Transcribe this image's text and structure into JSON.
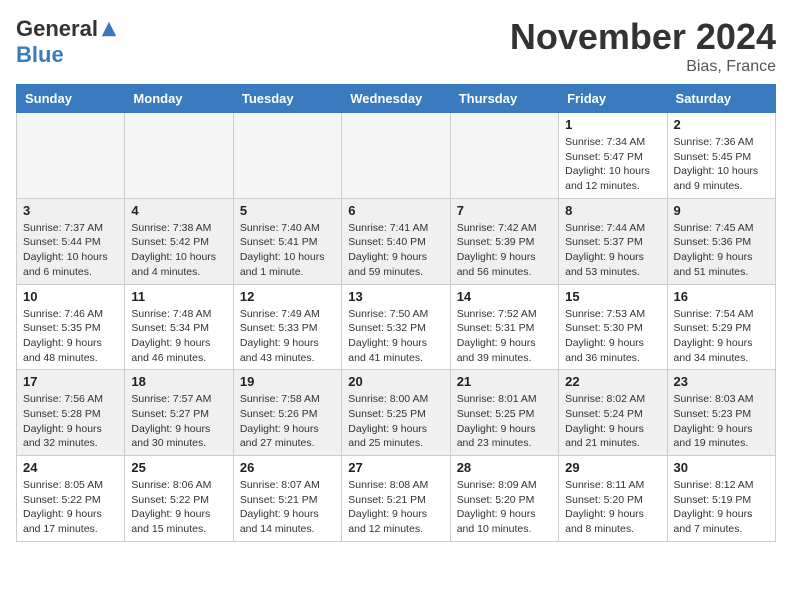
{
  "header": {
    "logo_general": "General",
    "logo_blue": "Blue",
    "month_title": "November 2024",
    "location": "Bias, France"
  },
  "weekdays": [
    "Sunday",
    "Monday",
    "Tuesday",
    "Wednesday",
    "Thursday",
    "Friday",
    "Saturday"
  ],
  "weeks": [
    [
      {
        "day": "",
        "empty": true
      },
      {
        "day": "",
        "empty": true
      },
      {
        "day": "",
        "empty": true
      },
      {
        "day": "",
        "empty": true
      },
      {
        "day": "",
        "empty": true
      },
      {
        "day": "1",
        "sunrise": "Sunrise: 7:34 AM",
        "sunset": "Sunset: 5:47 PM",
        "daylight": "Daylight: 10 hours and 12 minutes."
      },
      {
        "day": "2",
        "sunrise": "Sunrise: 7:36 AM",
        "sunset": "Sunset: 5:45 PM",
        "daylight": "Daylight: 10 hours and 9 minutes."
      }
    ],
    [
      {
        "day": "3",
        "sunrise": "Sunrise: 7:37 AM",
        "sunset": "Sunset: 5:44 PM",
        "daylight": "Daylight: 10 hours and 6 minutes."
      },
      {
        "day": "4",
        "sunrise": "Sunrise: 7:38 AM",
        "sunset": "Sunset: 5:42 PM",
        "daylight": "Daylight: 10 hours and 4 minutes."
      },
      {
        "day": "5",
        "sunrise": "Sunrise: 7:40 AM",
        "sunset": "Sunset: 5:41 PM",
        "daylight": "Daylight: 10 hours and 1 minute."
      },
      {
        "day": "6",
        "sunrise": "Sunrise: 7:41 AM",
        "sunset": "Sunset: 5:40 PM",
        "daylight": "Daylight: 9 hours and 59 minutes."
      },
      {
        "day": "7",
        "sunrise": "Sunrise: 7:42 AM",
        "sunset": "Sunset: 5:39 PM",
        "daylight": "Daylight: 9 hours and 56 minutes."
      },
      {
        "day": "8",
        "sunrise": "Sunrise: 7:44 AM",
        "sunset": "Sunset: 5:37 PM",
        "daylight": "Daylight: 9 hours and 53 minutes."
      },
      {
        "day": "9",
        "sunrise": "Sunrise: 7:45 AM",
        "sunset": "Sunset: 5:36 PM",
        "daylight": "Daylight: 9 hours and 51 minutes."
      }
    ],
    [
      {
        "day": "10",
        "sunrise": "Sunrise: 7:46 AM",
        "sunset": "Sunset: 5:35 PM",
        "daylight": "Daylight: 9 hours and 48 minutes."
      },
      {
        "day": "11",
        "sunrise": "Sunrise: 7:48 AM",
        "sunset": "Sunset: 5:34 PM",
        "daylight": "Daylight: 9 hours and 46 minutes."
      },
      {
        "day": "12",
        "sunrise": "Sunrise: 7:49 AM",
        "sunset": "Sunset: 5:33 PM",
        "daylight": "Daylight: 9 hours and 43 minutes."
      },
      {
        "day": "13",
        "sunrise": "Sunrise: 7:50 AM",
        "sunset": "Sunset: 5:32 PM",
        "daylight": "Daylight: 9 hours and 41 minutes."
      },
      {
        "day": "14",
        "sunrise": "Sunrise: 7:52 AM",
        "sunset": "Sunset: 5:31 PM",
        "daylight": "Daylight: 9 hours and 39 minutes."
      },
      {
        "day": "15",
        "sunrise": "Sunrise: 7:53 AM",
        "sunset": "Sunset: 5:30 PM",
        "daylight": "Daylight: 9 hours and 36 minutes."
      },
      {
        "day": "16",
        "sunrise": "Sunrise: 7:54 AM",
        "sunset": "Sunset: 5:29 PM",
        "daylight": "Daylight: 9 hours and 34 minutes."
      }
    ],
    [
      {
        "day": "17",
        "sunrise": "Sunrise: 7:56 AM",
        "sunset": "Sunset: 5:28 PM",
        "daylight": "Daylight: 9 hours and 32 minutes."
      },
      {
        "day": "18",
        "sunrise": "Sunrise: 7:57 AM",
        "sunset": "Sunset: 5:27 PM",
        "daylight": "Daylight: 9 hours and 30 minutes."
      },
      {
        "day": "19",
        "sunrise": "Sunrise: 7:58 AM",
        "sunset": "Sunset: 5:26 PM",
        "daylight": "Daylight: 9 hours and 27 minutes."
      },
      {
        "day": "20",
        "sunrise": "Sunrise: 8:00 AM",
        "sunset": "Sunset: 5:25 PM",
        "daylight": "Daylight: 9 hours and 25 minutes."
      },
      {
        "day": "21",
        "sunrise": "Sunrise: 8:01 AM",
        "sunset": "Sunset: 5:25 PM",
        "daylight": "Daylight: 9 hours and 23 minutes."
      },
      {
        "day": "22",
        "sunrise": "Sunrise: 8:02 AM",
        "sunset": "Sunset: 5:24 PM",
        "daylight": "Daylight: 9 hours and 21 minutes."
      },
      {
        "day": "23",
        "sunrise": "Sunrise: 8:03 AM",
        "sunset": "Sunset: 5:23 PM",
        "daylight": "Daylight: 9 hours and 19 minutes."
      }
    ],
    [
      {
        "day": "24",
        "sunrise": "Sunrise: 8:05 AM",
        "sunset": "Sunset: 5:22 PM",
        "daylight": "Daylight: 9 hours and 17 minutes."
      },
      {
        "day": "25",
        "sunrise": "Sunrise: 8:06 AM",
        "sunset": "Sunset: 5:22 PM",
        "daylight": "Daylight: 9 hours and 15 minutes."
      },
      {
        "day": "26",
        "sunrise": "Sunrise: 8:07 AM",
        "sunset": "Sunset: 5:21 PM",
        "daylight": "Daylight: 9 hours and 14 minutes."
      },
      {
        "day": "27",
        "sunrise": "Sunrise: 8:08 AM",
        "sunset": "Sunset: 5:21 PM",
        "daylight": "Daylight: 9 hours and 12 minutes."
      },
      {
        "day": "28",
        "sunrise": "Sunrise: 8:09 AM",
        "sunset": "Sunset: 5:20 PM",
        "daylight": "Daylight: 9 hours and 10 minutes."
      },
      {
        "day": "29",
        "sunrise": "Sunrise: 8:11 AM",
        "sunset": "Sunset: 5:20 PM",
        "daylight": "Daylight: 9 hours and 8 minutes."
      },
      {
        "day": "30",
        "sunrise": "Sunrise: 8:12 AM",
        "sunset": "Sunset: 5:19 PM",
        "daylight": "Daylight: 9 hours and 7 minutes."
      }
    ]
  ],
  "row_classes": [
    "row-a",
    "row-b",
    "row-a",
    "row-b",
    "row-a"
  ]
}
